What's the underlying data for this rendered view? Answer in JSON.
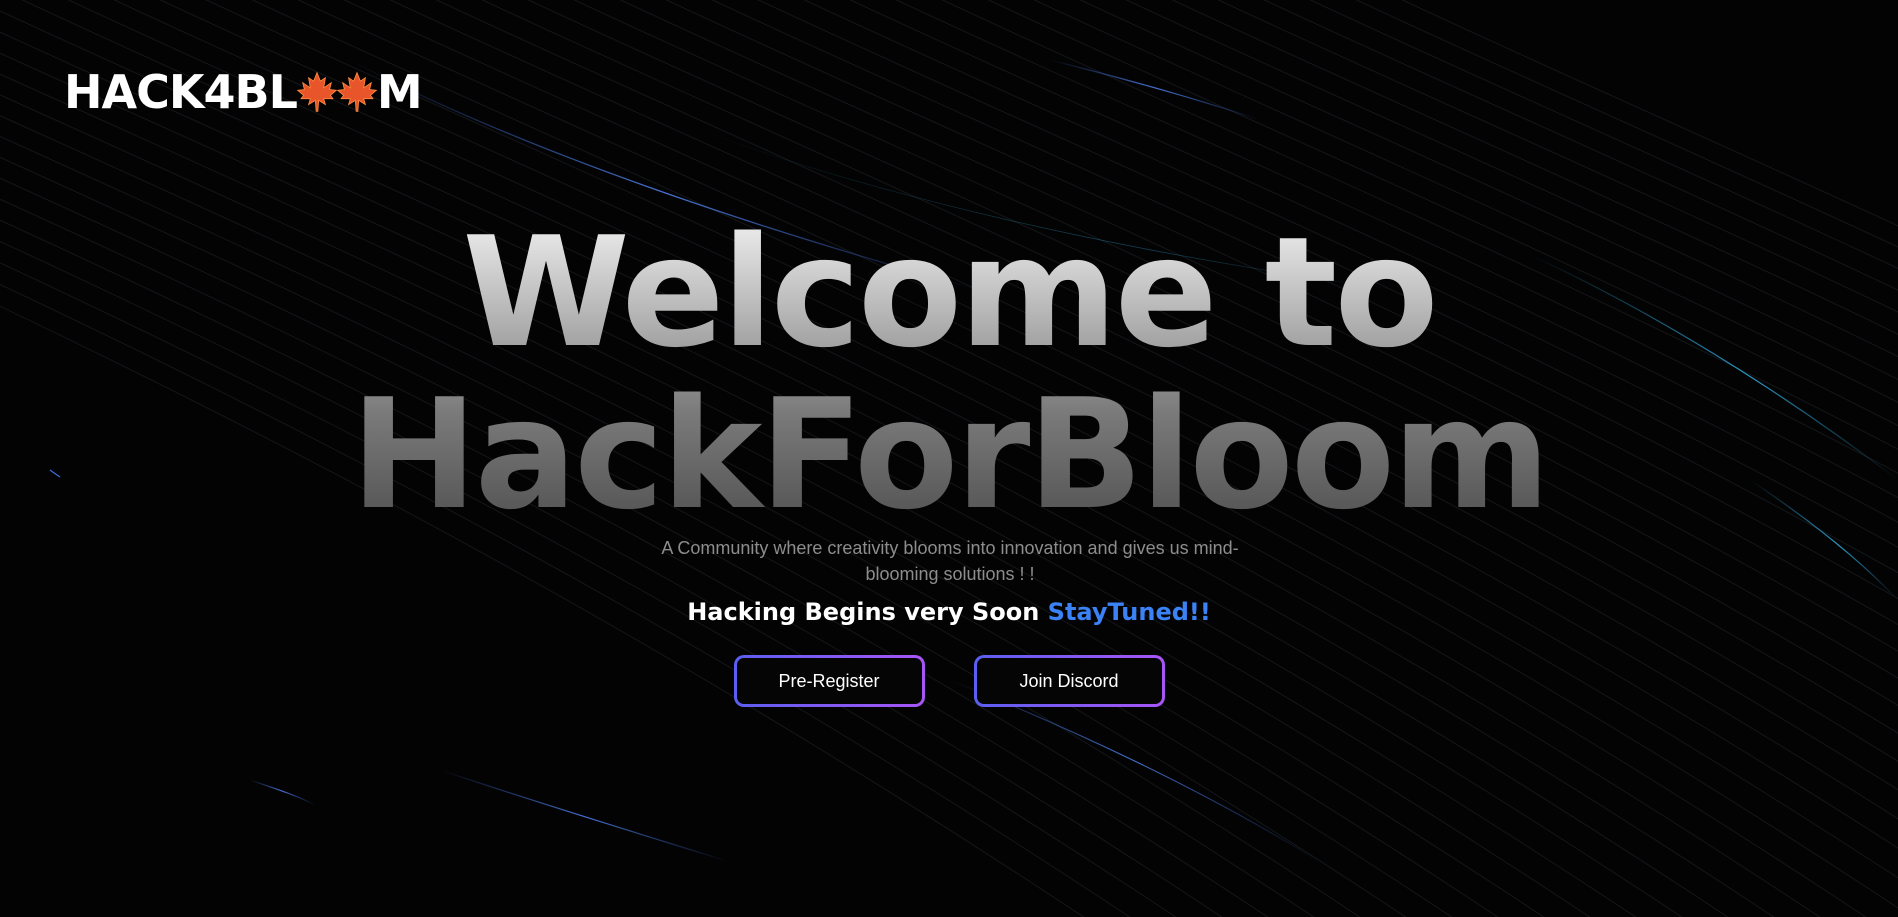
{
  "brand": {
    "logo_prefix": "HACK4BL",
    "logo_suffix": "M",
    "leaf_icon_count": 2,
    "leaf_color": "#e8552a"
  },
  "hero": {
    "title_line1": "Welcome to",
    "title_line2": "HackForBloom",
    "subtitle": "A Community where creativity blooms into innovation and gives us mind-blooming solutions ! !"
  },
  "tagline": {
    "text": "Hacking Begins very Soon ",
    "accent": "StayTuned!!",
    "accent_color": "#3b82f6"
  },
  "actions": {
    "pre_register": "Pre-Register",
    "join_discord": "Join Discord"
  },
  "theme": {
    "background": "#030303",
    "button_gradient": [
      "#5b5ef0",
      "#a855f7"
    ]
  }
}
